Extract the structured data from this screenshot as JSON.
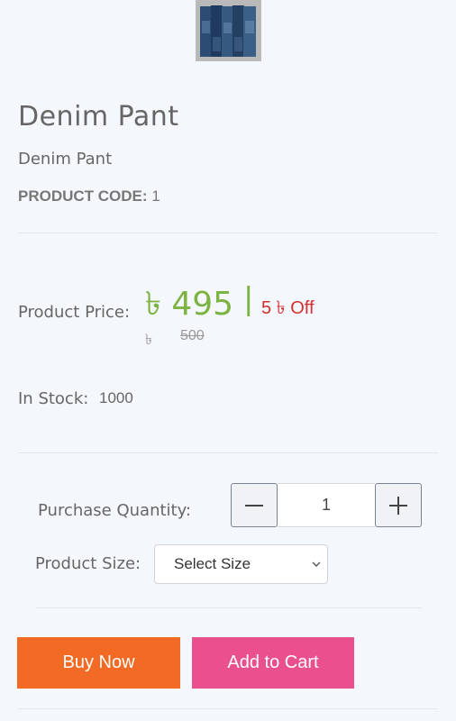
{
  "product": {
    "image_alt": "denim-pants-thumbnail",
    "title": "Denim Pant",
    "subtitle": "Denim Pant",
    "code_label": "PRODUCT CODE:",
    "code_value": "1"
  },
  "price": {
    "label": "Product Price:",
    "current": "৳ 495",
    "separator": "|",
    "discount": "5 ৳ Off",
    "old_currency": "৳",
    "old_value": "500",
    "current_color": "#7cb342",
    "discount_color": "#d32f2f"
  },
  "stock": {
    "label": "In Stock:",
    "value": "1000"
  },
  "quantity": {
    "label": "Purchase Quantity:",
    "value": "1",
    "decrement_icon": "minus-icon",
    "increment_icon": "plus-icon"
  },
  "size": {
    "label": "Product Size:",
    "selected": "Select Size",
    "icon": "chevron-down-icon"
  },
  "actions": {
    "buy_now": "Buy Now",
    "add_to_cart": "Add to Cart",
    "buy_color": "#f26a23",
    "cart_color": "#ea4f8e"
  }
}
